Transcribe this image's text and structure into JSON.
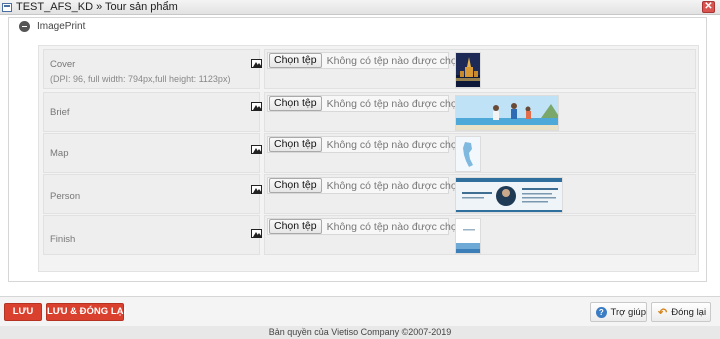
{
  "window": {
    "title": "TEST_AFS_KD » Tour sản phẩm",
    "close_label": "✕"
  },
  "section": {
    "title": "ImagePrint"
  },
  "file_input": {
    "button_label": "Chọn tệp",
    "status": "Không có tệp nào được chọn"
  },
  "rows": [
    {
      "label": "Cover",
      "sublabel": "(DPI: 96, full width: 794px,full height: 1123px)"
    },
    {
      "label": "Brief",
      "sublabel": ""
    },
    {
      "label": "Map",
      "sublabel": ""
    },
    {
      "label": "Person",
      "sublabel": ""
    },
    {
      "label": "Finish",
      "sublabel": ""
    }
  ],
  "footer": {
    "save_label": "LƯU",
    "save_close_label": "LƯU & ĐÓNG LẠI",
    "help_label": "Trợ giúp",
    "close_label": "Đóng lại",
    "copyright": "Bản quyền của Vietiso Company ©2007-2019"
  },
  "colors": {
    "accent_red": "#d9412e",
    "help_blue": "#3b7dc4"
  }
}
